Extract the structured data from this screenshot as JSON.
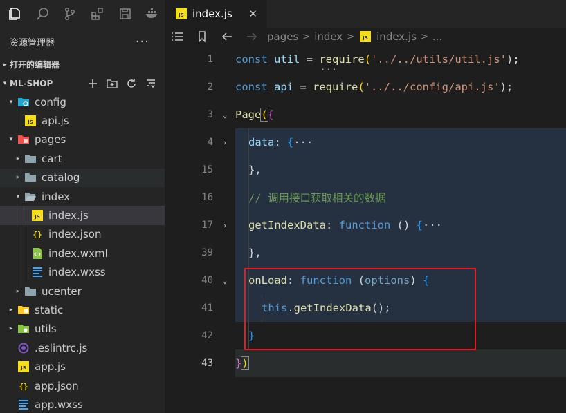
{
  "explorer": {
    "title": "资源管理器",
    "more": "···",
    "open_editors": "打开的编辑器",
    "project": "ML-SHOP",
    "tree": [
      {
        "label": "config",
        "icon": "folder-config-icon"
      },
      {
        "label": "api.js",
        "icon": "js-file-icon"
      },
      {
        "label": "pages",
        "icon": "folder-pages-icon"
      },
      {
        "label": "cart",
        "icon": "folder-icon"
      },
      {
        "label": "catalog",
        "icon": "folder-icon"
      },
      {
        "label": "index",
        "icon": "folder-open-icon"
      },
      {
        "label": "index.js",
        "icon": "js-file-icon"
      },
      {
        "label": "index.json",
        "icon": "json-file-icon"
      },
      {
        "label": "index.wxml",
        "icon": "wxml-file-icon"
      },
      {
        "label": "index.wxss",
        "icon": "css-file-icon"
      },
      {
        "label": "ucenter",
        "icon": "folder-icon"
      },
      {
        "label": "static",
        "icon": "folder-static-icon"
      },
      {
        "label": "utils",
        "icon": "folder-utils-icon"
      },
      {
        "label": ".eslintrc.js",
        "icon": "eslint-file-icon"
      },
      {
        "label": "app.js",
        "icon": "js-file-icon"
      },
      {
        "label": "app.json",
        "icon": "json-file-icon"
      },
      {
        "label": "app.wxss",
        "icon": "css-file-icon"
      }
    ]
  },
  "tab": {
    "label": "index.js",
    "close": "✕"
  },
  "breadcrumbs": {
    "b1": "pages",
    "b2": "index",
    "b3": "index.js",
    "b4": "..."
  },
  "code": {
    "ln": [
      "1",
      "2",
      "3",
      "4",
      "15",
      "16",
      "17",
      "39",
      "40",
      "41",
      "42",
      "43"
    ],
    "l1": {
      "kw": "const",
      "name": " util ",
      "eq": "= ",
      "fn": "require",
      "open": "(",
      "str": "'../../utils/util.js'",
      "close": ");"
    },
    "l2": {
      "kw": "const",
      "name": " api ",
      "eq": "= ",
      "fn": "require",
      "open": "(",
      "str": "'../../config/api.js'",
      "close": ");"
    },
    "l3": {
      "fn": "Page",
      "p1": "(",
      "p2": "{"
    },
    "l4": {
      "prop": "data",
      "colon": ": ",
      "brace": "{",
      "ell": "···"
    },
    "l15": {
      "text": "},"
    },
    "l16": {
      "comment": "// 调用接口获取相关的数据"
    },
    "l17": {
      "fn": "getIndexData",
      "colon": ": ",
      "kw": "function",
      "paren": " () ",
      "brace": "{",
      "ell": "···"
    },
    "l39": {
      "text": "},"
    },
    "l40": {
      "fn": "onLoad",
      "colon": ": ",
      "kw": "function",
      "p1": " (",
      "param": "options",
      "p2": ")",
      "brace": " {"
    },
    "l41": {
      "this": "this",
      "dot": ".",
      "fn": "getIndexData",
      "call": "();"
    },
    "l42": {
      "brace": "}"
    },
    "l43": {
      "p2": "}",
      "p1": ")"
    }
  },
  "colors": {
    "accent_box": "#e31c23",
    "selection": "#37373d"
  }
}
